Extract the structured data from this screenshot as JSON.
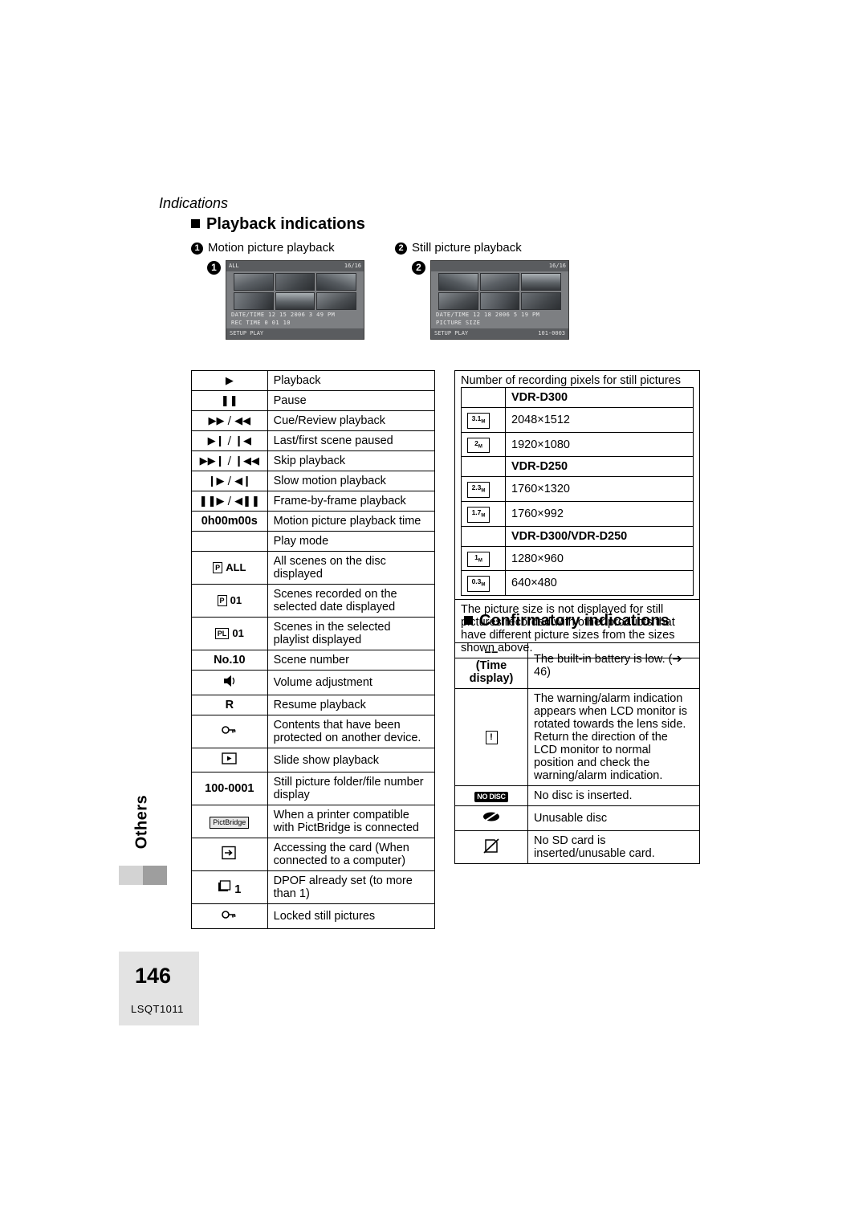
{
  "page": {
    "side_tab_label": "Others",
    "section_title": "Indications",
    "page_number": "146",
    "model_code": "LSQT1011"
  },
  "headings": {
    "playback": "Playback indications",
    "confirmatory": "Confirmatory indications"
  },
  "callouts": {
    "one_num": "1",
    "one_label": "Motion picture playback",
    "two_num": "2",
    "two_label": "Still picture playback"
  },
  "lcd1": {
    "top_left": "ALL",
    "top_right": "16/16",
    "line1": "DATE/TIME  12 15 2006   3 49 PM",
    "line2": "REC TIME  0 01 10",
    "bottom_left": "SETUP   PLAY",
    "bottom_right": ""
  },
  "lcd2": {
    "top_left": "",
    "top_right": "16/16",
    "line1": "DATE/TIME  12 18 2006   5 19 PM",
    "line2": "PICTURE SIZE",
    "bottom_left": "SETUP   PLAY",
    "bottom_right": "101-0003"
  },
  "playback_table": [
    {
      "icon": "▶",
      "icon_kind": "glyph",
      "desc": "Playback"
    },
    {
      "icon": "❚❚",
      "icon_kind": "glyph",
      "desc": "Pause"
    },
    {
      "icon": "▶▶ / ◀◀",
      "icon_kind": "glyph",
      "desc": "Cue/Review playback"
    },
    {
      "icon": "▶❙ / ❙◀",
      "icon_kind": "glyph",
      "desc": "Last/first scene paused"
    },
    {
      "icon": "▶▶❙ / ❙◀◀",
      "icon_kind": "glyph",
      "desc": "Skip playback"
    },
    {
      "icon": "❙▶ / ◀❙",
      "icon_kind": "glyph",
      "desc": "Slow motion playback"
    },
    {
      "icon": "❚❚▶ / ◀❚❚",
      "icon_kind": "glyph",
      "desc": "Frame-by-frame playback"
    },
    {
      "icon": "0h00m00s",
      "icon_kind": "bold",
      "desc": "Motion picture playback time"
    },
    {
      "icon": "",
      "icon_kind": "none",
      "desc": "Play mode"
    },
    {
      "icon": "ALL",
      "icon_kind": "boxed-p",
      "desc": "All scenes on the disc displayed"
    },
    {
      "icon": "01",
      "icon_kind": "boxed-p",
      "desc": "Scenes recorded on the selected date displayed"
    },
    {
      "icon": "01",
      "icon_kind": "boxed-pl",
      "desc": "Scenes in the selected playlist displayed"
    },
    {
      "icon": "No.10",
      "icon_kind": "bold",
      "desc": "Scene number"
    },
    {
      "icon": "speaker",
      "icon_kind": "icon-speaker",
      "desc": "Volume adjustment"
    },
    {
      "icon": "R",
      "icon_kind": "bold",
      "desc": "Resume playback"
    },
    {
      "icon": "key",
      "icon_kind": "icon-key",
      "desc": "Contents that have been protected on another device."
    },
    {
      "icon": "slideshow",
      "icon_kind": "icon-slideshow",
      "desc": "Slide show playback"
    },
    {
      "icon": "100-0001",
      "icon_kind": "bold",
      "desc": "Still picture folder/file number display"
    },
    {
      "icon": "PictBridge",
      "icon_kind": "pictbridge",
      "desc": "When a printer compatible with PictBridge is connected"
    },
    {
      "icon": "card-access",
      "icon_kind": "icon-access",
      "desc": "Accessing the card (When connected to a computer)"
    },
    {
      "icon": "1",
      "icon_kind": "icon-dpof",
      "desc": "DPOF already set (to more than 1)"
    },
    {
      "icon": "key-locked",
      "icon_kind": "icon-key",
      "desc": "Locked still pictures"
    }
  ],
  "pixels_table": {
    "heading": "Number of recording pixels for still pictures",
    "groups": [
      {
        "model": "VDR-D300",
        "rows": [
          {
            "icon": "3.1",
            "icon_unit": "M",
            "value": "2048×1512"
          },
          {
            "icon": "2",
            "icon_unit": "M",
            "value": "1920×1080"
          }
        ]
      },
      {
        "model": "VDR-D250",
        "rows": [
          {
            "icon": "2.3",
            "icon_unit": "M",
            "value": "1760×1320"
          },
          {
            "icon": "1.7",
            "icon_unit": "M",
            "value": "1760×992"
          }
        ]
      },
      {
        "model": "VDR-D300/VDR-D250",
        "rows": [
          {
            "icon": "1",
            "icon_unit": "M",
            "value": "1280×960"
          },
          {
            "icon": "0.3",
            "icon_unit": "M",
            "value": "640×480"
          }
        ]
      }
    ],
    "note": "The picture size is not displayed for still pictures recorded with other products that have different picture sizes from the sizes shown above."
  },
  "confirmatory_table": [
    {
      "icon": "−− (Time display)",
      "icon_kind": "text-bold",
      "desc": "The built-in battery is low. (➔ 46)"
    },
    {
      "icon": "!",
      "icon_kind": "alert",
      "desc": "The warning/alarm indication appears when LCD monitor is rotated towards the lens side. Return the direction of the LCD monitor to normal position and check the warning/alarm indication."
    },
    {
      "icon": "NO DISC",
      "icon_kind": "nodisc",
      "desc": "No disc is inserted."
    },
    {
      "icon": "unusable-disc",
      "icon_kind": "icon-disc-x",
      "desc": "Unusable disc"
    },
    {
      "icon": "no-sd-card",
      "icon_kind": "icon-card-x",
      "desc": "No SD card is inserted/unusable card."
    }
  ]
}
